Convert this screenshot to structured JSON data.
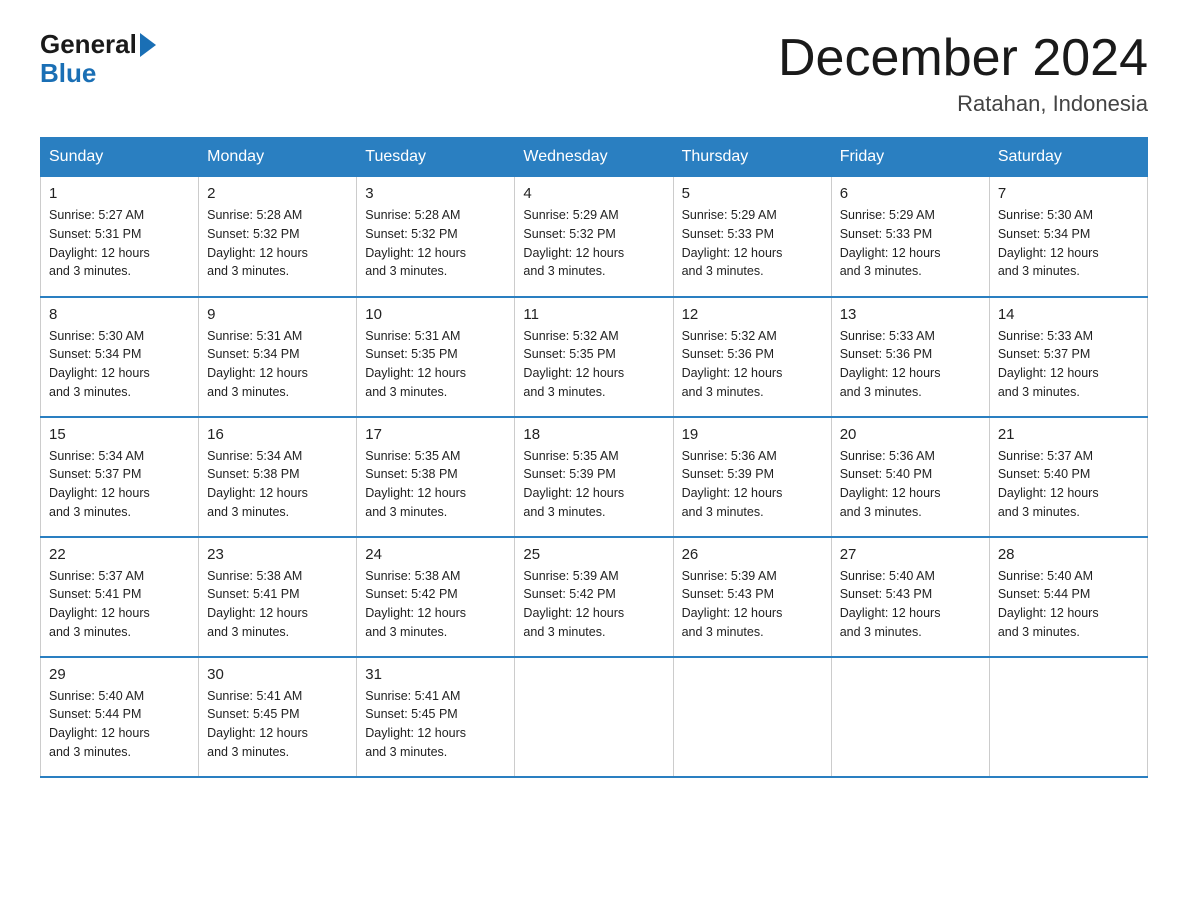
{
  "header": {
    "logo_general": "General",
    "logo_blue": "Blue",
    "month_title": "December 2024",
    "location": "Ratahan, Indonesia"
  },
  "days_of_week": [
    "Sunday",
    "Monday",
    "Tuesday",
    "Wednesday",
    "Thursday",
    "Friday",
    "Saturday"
  ],
  "weeks": [
    [
      {
        "day": "1",
        "sunrise": "5:27 AM",
        "sunset": "5:31 PM",
        "daylight": "12 hours and 3 minutes."
      },
      {
        "day": "2",
        "sunrise": "5:28 AM",
        "sunset": "5:32 PM",
        "daylight": "12 hours and 3 minutes."
      },
      {
        "day": "3",
        "sunrise": "5:28 AM",
        "sunset": "5:32 PM",
        "daylight": "12 hours and 3 minutes."
      },
      {
        "day": "4",
        "sunrise": "5:29 AM",
        "sunset": "5:32 PM",
        "daylight": "12 hours and 3 minutes."
      },
      {
        "day": "5",
        "sunrise": "5:29 AM",
        "sunset": "5:33 PM",
        "daylight": "12 hours and 3 minutes."
      },
      {
        "day": "6",
        "sunrise": "5:29 AM",
        "sunset": "5:33 PM",
        "daylight": "12 hours and 3 minutes."
      },
      {
        "day": "7",
        "sunrise": "5:30 AM",
        "sunset": "5:34 PM",
        "daylight": "12 hours and 3 minutes."
      }
    ],
    [
      {
        "day": "8",
        "sunrise": "5:30 AM",
        "sunset": "5:34 PM",
        "daylight": "12 hours and 3 minutes."
      },
      {
        "day": "9",
        "sunrise": "5:31 AM",
        "sunset": "5:34 PM",
        "daylight": "12 hours and 3 minutes."
      },
      {
        "day": "10",
        "sunrise": "5:31 AM",
        "sunset": "5:35 PM",
        "daylight": "12 hours and 3 minutes."
      },
      {
        "day": "11",
        "sunrise": "5:32 AM",
        "sunset": "5:35 PM",
        "daylight": "12 hours and 3 minutes."
      },
      {
        "day": "12",
        "sunrise": "5:32 AM",
        "sunset": "5:36 PM",
        "daylight": "12 hours and 3 minutes."
      },
      {
        "day": "13",
        "sunrise": "5:33 AM",
        "sunset": "5:36 PM",
        "daylight": "12 hours and 3 minutes."
      },
      {
        "day": "14",
        "sunrise": "5:33 AM",
        "sunset": "5:37 PM",
        "daylight": "12 hours and 3 minutes."
      }
    ],
    [
      {
        "day": "15",
        "sunrise": "5:34 AM",
        "sunset": "5:37 PM",
        "daylight": "12 hours and 3 minutes."
      },
      {
        "day": "16",
        "sunrise": "5:34 AM",
        "sunset": "5:38 PM",
        "daylight": "12 hours and 3 minutes."
      },
      {
        "day": "17",
        "sunrise": "5:35 AM",
        "sunset": "5:38 PM",
        "daylight": "12 hours and 3 minutes."
      },
      {
        "day": "18",
        "sunrise": "5:35 AM",
        "sunset": "5:39 PM",
        "daylight": "12 hours and 3 minutes."
      },
      {
        "day": "19",
        "sunrise": "5:36 AM",
        "sunset": "5:39 PM",
        "daylight": "12 hours and 3 minutes."
      },
      {
        "day": "20",
        "sunrise": "5:36 AM",
        "sunset": "5:40 PM",
        "daylight": "12 hours and 3 minutes."
      },
      {
        "day": "21",
        "sunrise": "5:37 AM",
        "sunset": "5:40 PM",
        "daylight": "12 hours and 3 minutes."
      }
    ],
    [
      {
        "day": "22",
        "sunrise": "5:37 AM",
        "sunset": "5:41 PM",
        "daylight": "12 hours and 3 minutes."
      },
      {
        "day": "23",
        "sunrise": "5:38 AM",
        "sunset": "5:41 PM",
        "daylight": "12 hours and 3 minutes."
      },
      {
        "day": "24",
        "sunrise": "5:38 AM",
        "sunset": "5:42 PM",
        "daylight": "12 hours and 3 minutes."
      },
      {
        "day": "25",
        "sunrise": "5:39 AM",
        "sunset": "5:42 PM",
        "daylight": "12 hours and 3 minutes."
      },
      {
        "day": "26",
        "sunrise": "5:39 AM",
        "sunset": "5:43 PM",
        "daylight": "12 hours and 3 minutes."
      },
      {
        "day": "27",
        "sunrise": "5:40 AM",
        "sunset": "5:43 PM",
        "daylight": "12 hours and 3 minutes."
      },
      {
        "day": "28",
        "sunrise": "5:40 AM",
        "sunset": "5:44 PM",
        "daylight": "12 hours and 3 minutes."
      }
    ],
    [
      {
        "day": "29",
        "sunrise": "5:40 AM",
        "sunset": "5:44 PM",
        "daylight": "12 hours and 3 minutes."
      },
      {
        "day": "30",
        "sunrise": "5:41 AM",
        "sunset": "5:45 PM",
        "daylight": "12 hours and 3 minutes."
      },
      {
        "day": "31",
        "sunrise": "5:41 AM",
        "sunset": "5:45 PM",
        "daylight": "12 hours and 3 minutes."
      },
      null,
      null,
      null,
      null
    ]
  ],
  "labels": {
    "sunrise": "Sunrise: ",
    "sunset": "Sunset: ",
    "daylight": "Daylight: "
  }
}
